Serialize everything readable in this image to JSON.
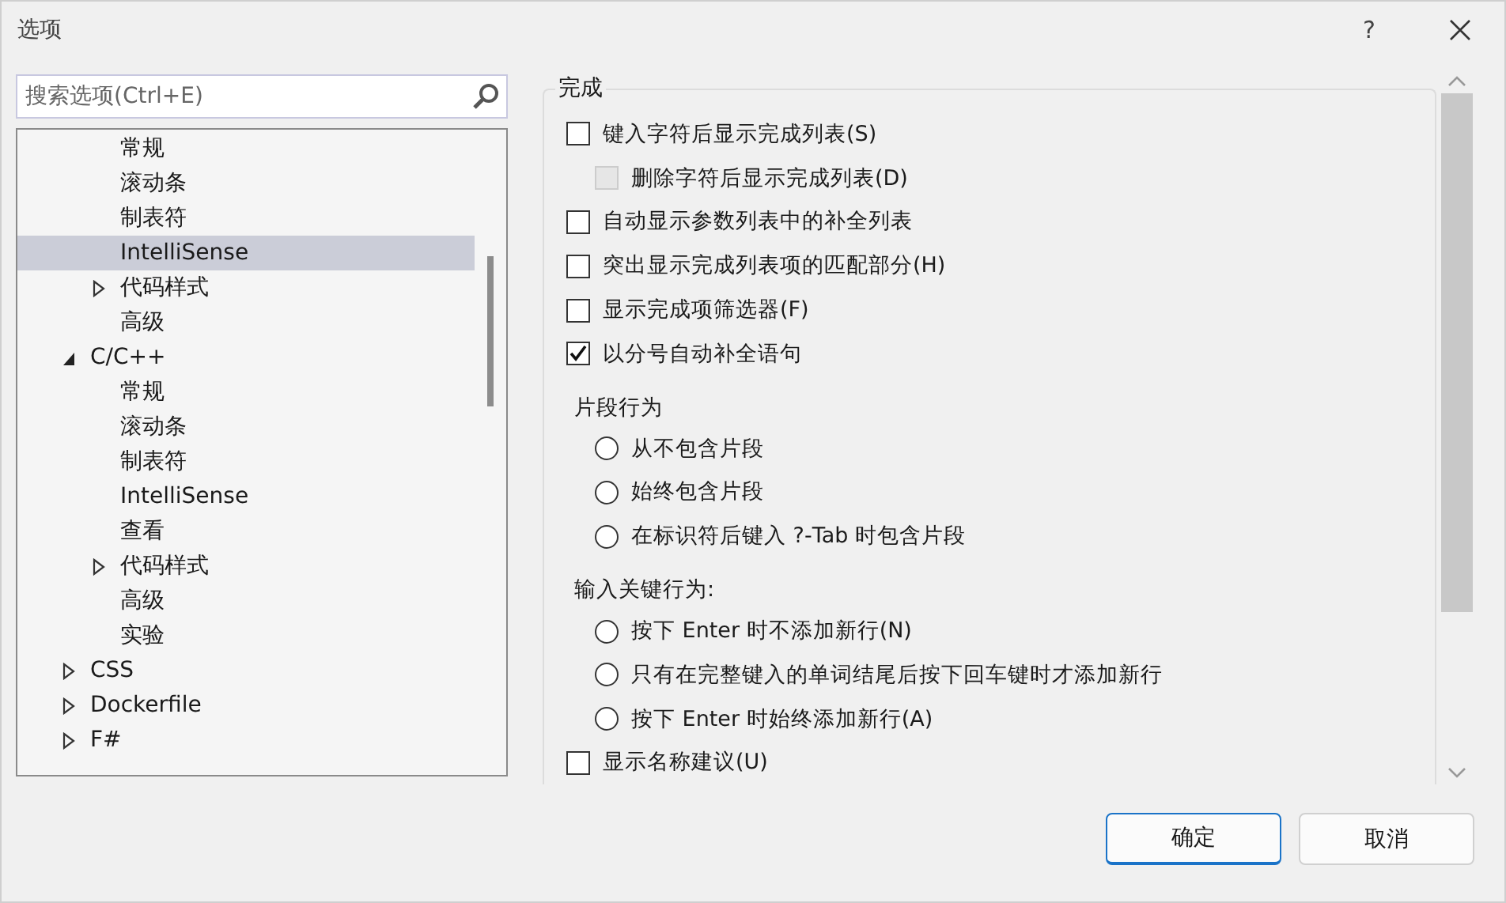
{
  "window": {
    "title": "选项",
    "help": "?"
  },
  "search": {
    "placeholder": "搜索选项(Ctrl+E)"
  },
  "tree": {
    "continued_children": [
      {
        "label": "常规",
        "selected": false
      },
      {
        "label": "滚动条",
        "selected": false
      },
      {
        "label": "制表符",
        "selected": false
      },
      {
        "label": "IntelliSense",
        "selected": true
      },
      {
        "label": "代码样式",
        "selected": false,
        "expanded": false
      },
      {
        "label": "高级",
        "selected": false
      }
    ],
    "items": [
      {
        "label": "C/C++",
        "selected": false,
        "expanded": true,
        "children": [
          {
            "label": "常规",
            "selected": false
          },
          {
            "label": "滚动条",
            "selected": false
          },
          {
            "label": "制表符",
            "selected": false
          },
          {
            "label": "IntelliSense",
            "selected": false
          },
          {
            "label": "查看",
            "selected": false
          },
          {
            "label": "代码样式",
            "selected": false,
            "expanded": false
          },
          {
            "label": "高级",
            "selected": false
          },
          {
            "label": "实验",
            "selected": false
          }
        ]
      },
      {
        "label": "CSS",
        "selected": false,
        "expanded": false
      },
      {
        "label": "Dockerfile",
        "selected": false,
        "expanded": false
      },
      {
        "label": "F#",
        "selected": false,
        "expanded": false
      }
    ]
  },
  "group": {
    "title": "完成",
    "options": [
      {
        "kind": "checkbox",
        "label": "键入字符后显示完成列表(S)",
        "checked": false,
        "disabled": false,
        "children": [
          {
            "kind": "checkbox",
            "label": "删除字符后显示完成列表(D)",
            "checked": false,
            "disabled": true
          }
        ]
      },
      {
        "kind": "checkbox",
        "label": "自动显示参数列表中的补全列表",
        "checked": false,
        "disabled": false
      },
      {
        "kind": "checkbox",
        "label": "突出显示完成列表项的匹配部分(H)",
        "checked": false,
        "disabled": false
      },
      {
        "kind": "checkbox",
        "label": "显示完成项筛选器(F)",
        "checked": false,
        "disabled": false
      },
      {
        "kind": "checkbox",
        "label": "以分号自动补全语句",
        "checked": true,
        "disabled": false
      },
      {
        "kind": "radiogroup",
        "label": "片段行为",
        "options": [
          {
            "label": "从不包含片段",
            "selected": false
          },
          {
            "label": "始终包含片段",
            "selected": false
          },
          {
            "label": "在标识符后键入 ?-Tab 时包含片段",
            "selected": false
          }
        ]
      },
      {
        "kind": "radiogroup",
        "label": "输入关键行为:",
        "options": [
          {
            "label": "按下 Enter 时不添加新行(N)",
            "selected": false
          },
          {
            "label": "只有在完整键入的单词结尾后按下回车键时才添加新行",
            "selected": false
          },
          {
            "label": "按下 Enter 时始终添加新行(A)",
            "selected": false
          }
        ]
      },
      {
        "kind": "checkbox",
        "label": "显示名称建议(U)",
        "checked": false,
        "disabled": false
      }
    ]
  },
  "buttons": [
    {
      "label": "确定",
      "default": true
    },
    {
      "label": "取消",
      "default": false
    }
  ]
}
